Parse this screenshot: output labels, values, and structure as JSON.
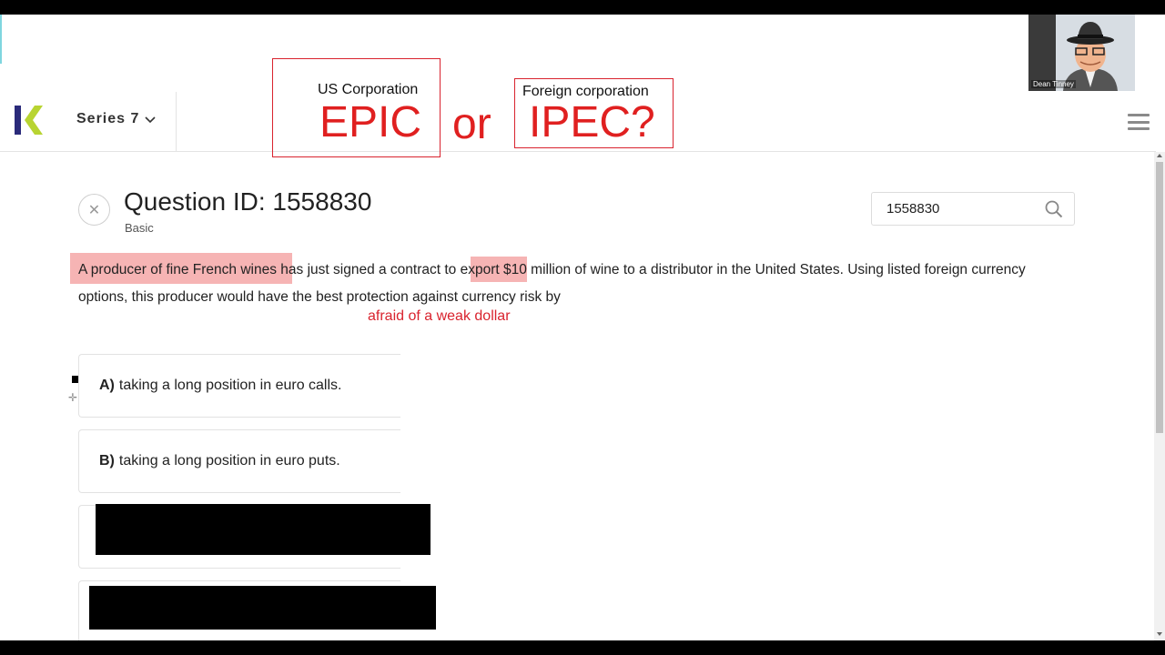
{
  "header": {
    "course_label": "Series 7"
  },
  "annotations": {
    "us_label": "US Corporation",
    "epic": "EPIC",
    "or": "or",
    "foreign_label": "Foreign corporation",
    "ipec": "IPEC?",
    "note": "afraid of a weak dollar"
  },
  "webcam": {
    "name": "Dean Tinney"
  },
  "question": {
    "title": "Question ID: 1558830",
    "level": "Basic",
    "text_part1": "A producer of fine French wines",
    "text_part2": " has just signed a contract to ",
    "text_part3": "export",
    "text_part4": " $10 million of wine to a distributor in the United States. Using listed foreign currency options, this producer would have the best protection against currency risk by"
  },
  "search": {
    "value": "1558830"
  },
  "answers": [
    {
      "letter": "A)",
      "text": "taking a long position in euro calls."
    },
    {
      "letter": "B)",
      "text": "taking a long position in euro puts."
    }
  ],
  "colors": {
    "annotation_red": "#e02020",
    "highlight": "#f4a7a7",
    "logo_navy": "#2a2a7a",
    "logo_green": "#b8d432"
  }
}
